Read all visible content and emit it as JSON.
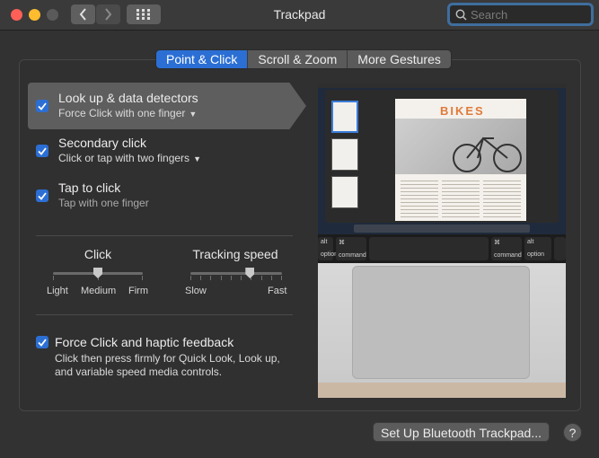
{
  "window": {
    "title": "Trackpad"
  },
  "search": {
    "placeholder": "Search"
  },
  "tabs": [
    {
      "label": "Point & Click",
      "active": true
    },
    {
      "label": "Scroll & Zoom",
      "active": false
    },
    {
      "label": "More Gestures",
      "active": false
    }
  ],
  "options": [
    {
      "title": "Look up & data detectors",
      "subtitle": "Force Click with one finger",
      "has_dropdown": true,
      "checked": true,
      "selected": true
    },
    {
      "title": "Secondary click",
      "subtitle": "Click or tap with two fingers",
      "has_dropdown": true,
      "checked": true,
      "selected": false
    },
    {
      "title": "Tap to click",
      "subtitle": "Tap with one finger",
      "has_dropdown": false,
      "checked": true,
      "selected": false
    }
  ],
  "click_slider": {
    "label": "Click",
    "min_label": "Light",
    "mid_label": "Medium",
    "max_label": "Firm",
    "value": "Medium"
  },
  "tracking_slider": {
    "label": "Tracking speed",
    "min_label": "Slow",
    "max_label": "Fast",
    "level": 0.65
  },
  "force_click": {
    "title": "Force Click and haptic feedback",
    "description": "Click then press firmly for Quick Look, Look up, and variable speed media controls.",
    "checked": true
  },
  "preview": {
    "doc_heading": "BIKES",
    "keys": {
      "left_alt": "alt",
      "left_option": "option",
      "left_cmd_symbol": "⌘",
      "left_command": "command",
      "right_cmd_symbol": "⌘",
      "right_command": "command",
      "right_alt": "alt",
      "right_option": "option"
    }
  },
  "footer": {
    "bluetooth_button": "Set Up Bluetooth Trackpad...",
    "help_label": "?"
  },
  "colors": {
    "accent": "#2b6fd4",
    "background": "#323232"
  }
}
